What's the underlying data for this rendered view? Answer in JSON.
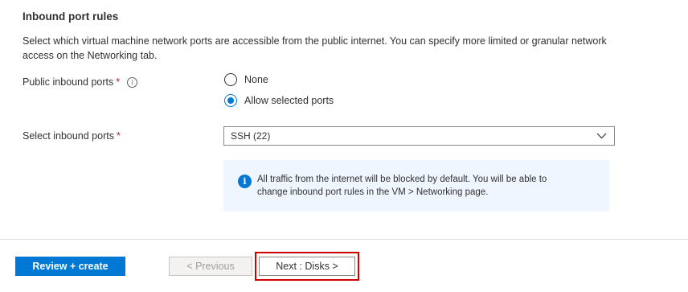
{
  "section": {
    "title": "Inbound port rules",
    "description": "Select which virtual machine network ports are accessible from the public internet. You can specify more limited or granular network access on the Networking tab."
  },
  "public_inbound_ports": {
    "label": "Public inbound ports",
    "required_marker": "*",
    "info_icon": "info-icon",
    "options": [
      {
        "label": "None",
        "selected": false
      },
      {
        "label": "Allow selected ports",
        "selected": true
      }
    ]
  },
  "select_inbound_ports": {
    "label": "Select inbound ports",
    "required_marker": "*",
    "value": "SSH (22)"
  },
  "info_box": {
    "icon": "info-icon",
    "text_line1": "All traffic from the internet will be blocked by default. You will be able to",
    "text_line2": "change inbound port rules in the VM > Networking page."
  },
  "footer": {
    "review_create": "Review + create",
    "previous": "< Previous",
    "next": "Next : Disks >"
  },
  "colors": {
    "accent": "#0078d4",
    "required": "#a4262c",
    "highlight": "#d00000",
    "info_background": "#f0f6ff"
  }
}
